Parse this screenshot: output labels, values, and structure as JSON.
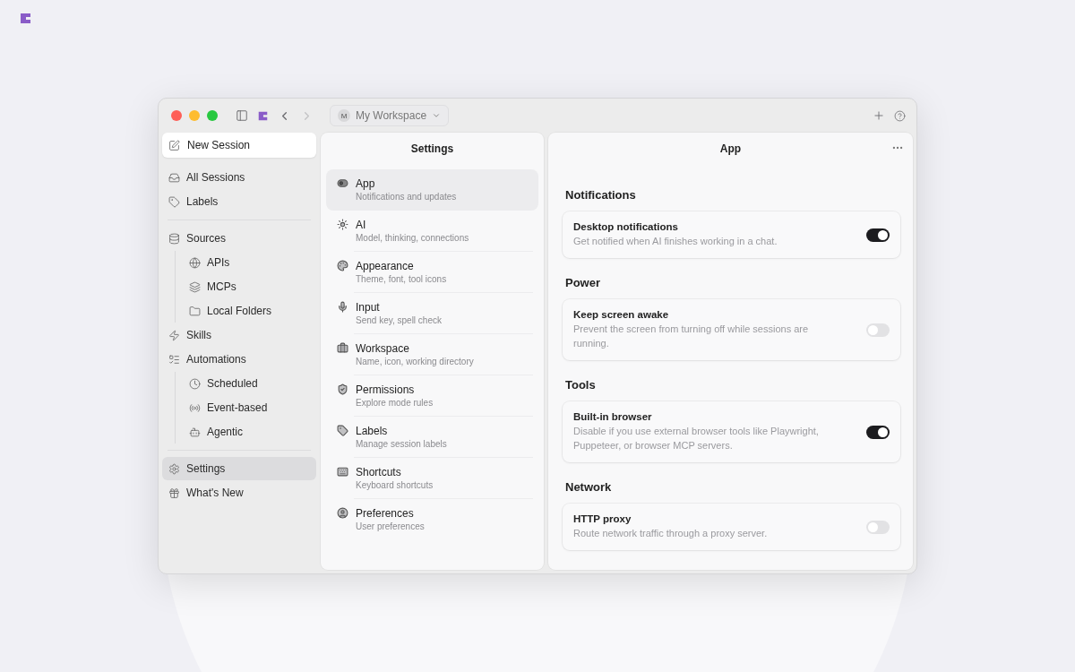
{
  "titlebar": {
    "avatar": "M",
    "workspace": "My Workspace",
    "back_disabled": false,
    "forward_disabled": true
  },
  "sidebar": {
    "new_session": "New Session",
    "groups": [
      [
        {
          "label": "All Sessions",
          "selected": false
        },
        {
          "label": "Labels",
          "selected": false
        }
      ],
      [
        {
          "label": "Sources",
          "selected": false,
          "children": [
            {
              "label": "APIs",
              "selected": false
            },
            {
              "label": "MCPs",
              "selected": false
            },
            {
              "label": "Local Folders",
              "selected": false
            }
          ]
        },
        {
          "label": "Skills",
          "selected": false
        },
        {
          "label": "Automations",
          "selected": false,
          "children": [
            {
              "label": "Scheduled",
              "selected": false
            },
            {
              "label": "Event-based",
              "selected": false
            },
            {
              "label": "Agentic",
              "selected": false
            }
          ]
        }
      ],
      [
        {
          "label": "Settings",
          "selected": true
        },
        {
          "label": "What's New",
          "selected": false
        }
      ]
    ]
  },
  "settings": {
    "title": "Settings",
    "items": [
      {
        "title": "App",
        "subtitle": "Notifications and updates",
        "selected": true
      },
      {
        "title": "AI",
        "subtitle": "Model, thinking, connections",
        "selected": false
      },
      {
        "title": "Appearance",
        "subtitle": "Theme, font, tool icons",
        "selected": false
      },
      {
        "title": "Input",
        "subtitle": "Send key, spell check",
        "selected": false
      },
      {
        "title": "Workspace",
        "subtitle": "Name, icon, working directory",
        "selected": false
      },
      {
        "title": "Permissions",
        "subtitle": "Explore mode rules",
        "selected": false
      },
      {
        "title": "Labels",
        "subtitle": "Manage session labels",
        "selected": false
      },
      {
        "title": "Shortcuts",
        "subtitle": "Keyboard shortcuts",
        "selected": false
      },
      {
        "title": "Preferences",
        "subtitle": "User preferences",
        "selected": false
      }
    ]
  },
  "detail": {
    "title": "App",
    "sections": [
      {
        "heading": "Notifications",
        "items": [
          {
            "title": "Desktop notifications",
            "description": "Get notified when AI finishes working in a chat.",
            "on": true
          }
        ]
      },
      {
        "heading": "Power",
        "items": [
          {
            "title": "Keep screen awake",
            "description": "Prevent the screen from turning off while sessions are running.",
            "on": false
          }
        ]
      },
      {
        "heading": "Tools",
        "items": [
          {
            "title": "Built-in browser",
            "description": "Disable if you use external browser tools like Playwright, Puppeteer, or browser MCP servers.",
            "on": true
          }
        ]
      },
      {
        "heading": "Network",
        "items": [
          {
            "title": "HTTP proxy",
            "description": "Route network traffic through a proxy server.",
            "on": false
          }
        ]
      }
    ]
  }
}
